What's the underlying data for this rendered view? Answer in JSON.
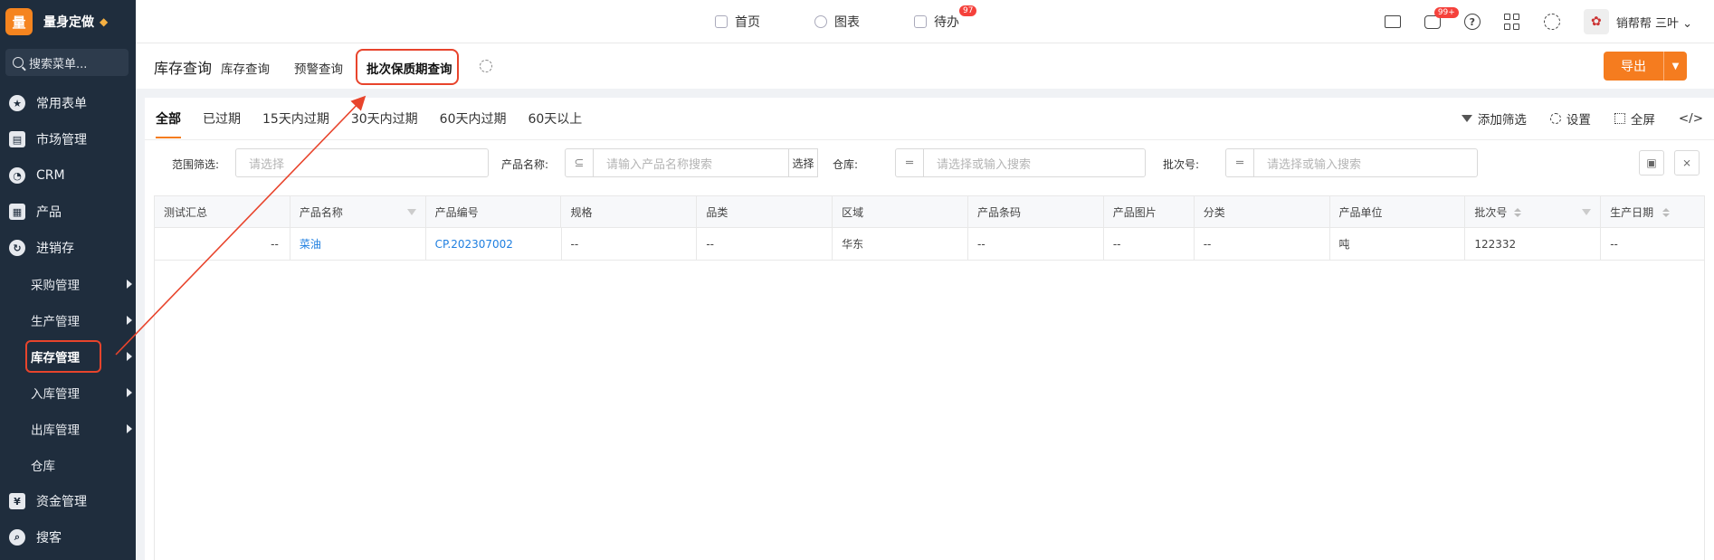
{
  "brand": {
    "logo_char": "量",
    "name": "量身定做"
  },
  "search": {
    "placeholder": "搜索菜单..."
  },
  "nav": {
    "items": [
      {
        "label": "常用表单",
        "icon": "star-icon"
      },
      {
        "label": "市场管理",
        "icon": "clipboard-icon"
      },
      {
        "label": "CRM",
        "icon": "pie-icon"
      },
      {
        "label": "产品",
        "icon": "boxes-icon"
      },
      {
        "label": "进销存",
        "icon": "cycle-icon"
      }
    ],
    "sub_items": [
      {
        "label": "采购管理",
        "arrow": true
      },
      {
        "label": "生产管理",
        "arrow": true
      },
      {
        "label": "库存管理",
        "arrow": true
      },
      {
        "label": "入库管理",
        "arrow": true
      },
      {
        "label": "出库管理",
        "arrow": true
      },
      {
        "label": "仓库",
        "arrow": false
      }
    ],
    "bottom_items": [
      {
        "label": "资金管理",
        "icon": "money-icon"
      },
      {
        "label": "搜客",
        "icon": "search-icon"
      }
    ]
  },
  "topbar": {
    "home": "首页",
    "charts": "图表",
    "todo": "待办",
    "todo_badge": "97",
    "chat_badge": "99+",
    "username": "销帮帮 三叶"
  },
  "pagebar": {
    "title": "库存查询",
    "tabs": [
      "库存查询",
      "预警查询",
      "批次保质期查询"
    ],
    "export": "导出"
  },
  "filter_tabs": [
    "全部",
    "已过期",
    "15天内过期",
    "30天内过期",
    "60天内过期",
    "60天以上"
  ],
  "card_actions": {
    "add_filter": "添加筛选",
    "settings": "设置",
    "fullscreen": "全屏",
    "code": "</>"
  },
  "filters": {
    "range_label": "范围筛选:",
    "range_placeholder": "请选择",
    "product_label": "产品名称:",
    "product_placeholder": "请输入产品名称搜索",
    "product_select": "选择",
    "warehouse_label": "仓库:",
    "warehouse_placeholder": "请选择或输入搜索",
    "batch_label": "批次号:",
    "batch_placeholder": "请选择或输入搜索"
  },
  "table": {
    "columns": [
      "测试汇总",
      "产品名称",
      "产品编号",
      "规格",
      "品类",
      "区域",
      "产品条码",
      "产品图片",
      "分类",
      "产品单位",
      "批次号",
      "生产日期"
    ],
    "rows": [
      [
        "--",
        "菜油",
        "CP.202307002",
        "--",
        "--",
        "华东",
        "--",
        "--",
        "--",
        "吨",
        "122332",
        "--"
      ]
    ]
  }
}
